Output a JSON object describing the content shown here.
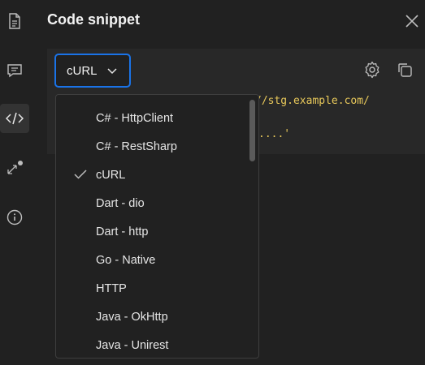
{
  "panel": {
    "title": "Code snippet"
  },
  "selector": {
    "selected": "cURL"
  },
  "code": {
    "line1": "//stg.example.com/",
    "line2": "....'"
  },
  "dropdown": {
    "options": [
      {
        "label": "C# - HttpClient",
        "checked": false
      },
      {
        "label": "C# - RestSharp",
        "checked": false
      },
      {
        "label": "cURL",
        "checked": true
      },
      {
        "label": "Dart - dio",
        "checked": false
      },
      {
        "label": "Dart - http",
        "checked": false
      },
      {
        "label": "Go - Native",
        "checked": false
      },
      {
        "label": "HTTP",
        "checked": false
      },
      {
        "label": "Java - OkHttp",
        "checked": false
      },
      {
        "label": "Java - Unirest",
        "checked": false
      }
    ]
  },
  "icons": {
    "rail": [
      "document-icon",
      "comment-icon",
      "code-icon",
      "related-collections-icon",
      "info-icon"
    ],
    "toolbar": [
      "gear-icon",
      "copy-icon",
      "close-icon"
    ]
  },
  "colors": {
    "accent": "#1a73e8",
    "background": "#212121",
    "code_text": "#e8c85a"
  }
}
